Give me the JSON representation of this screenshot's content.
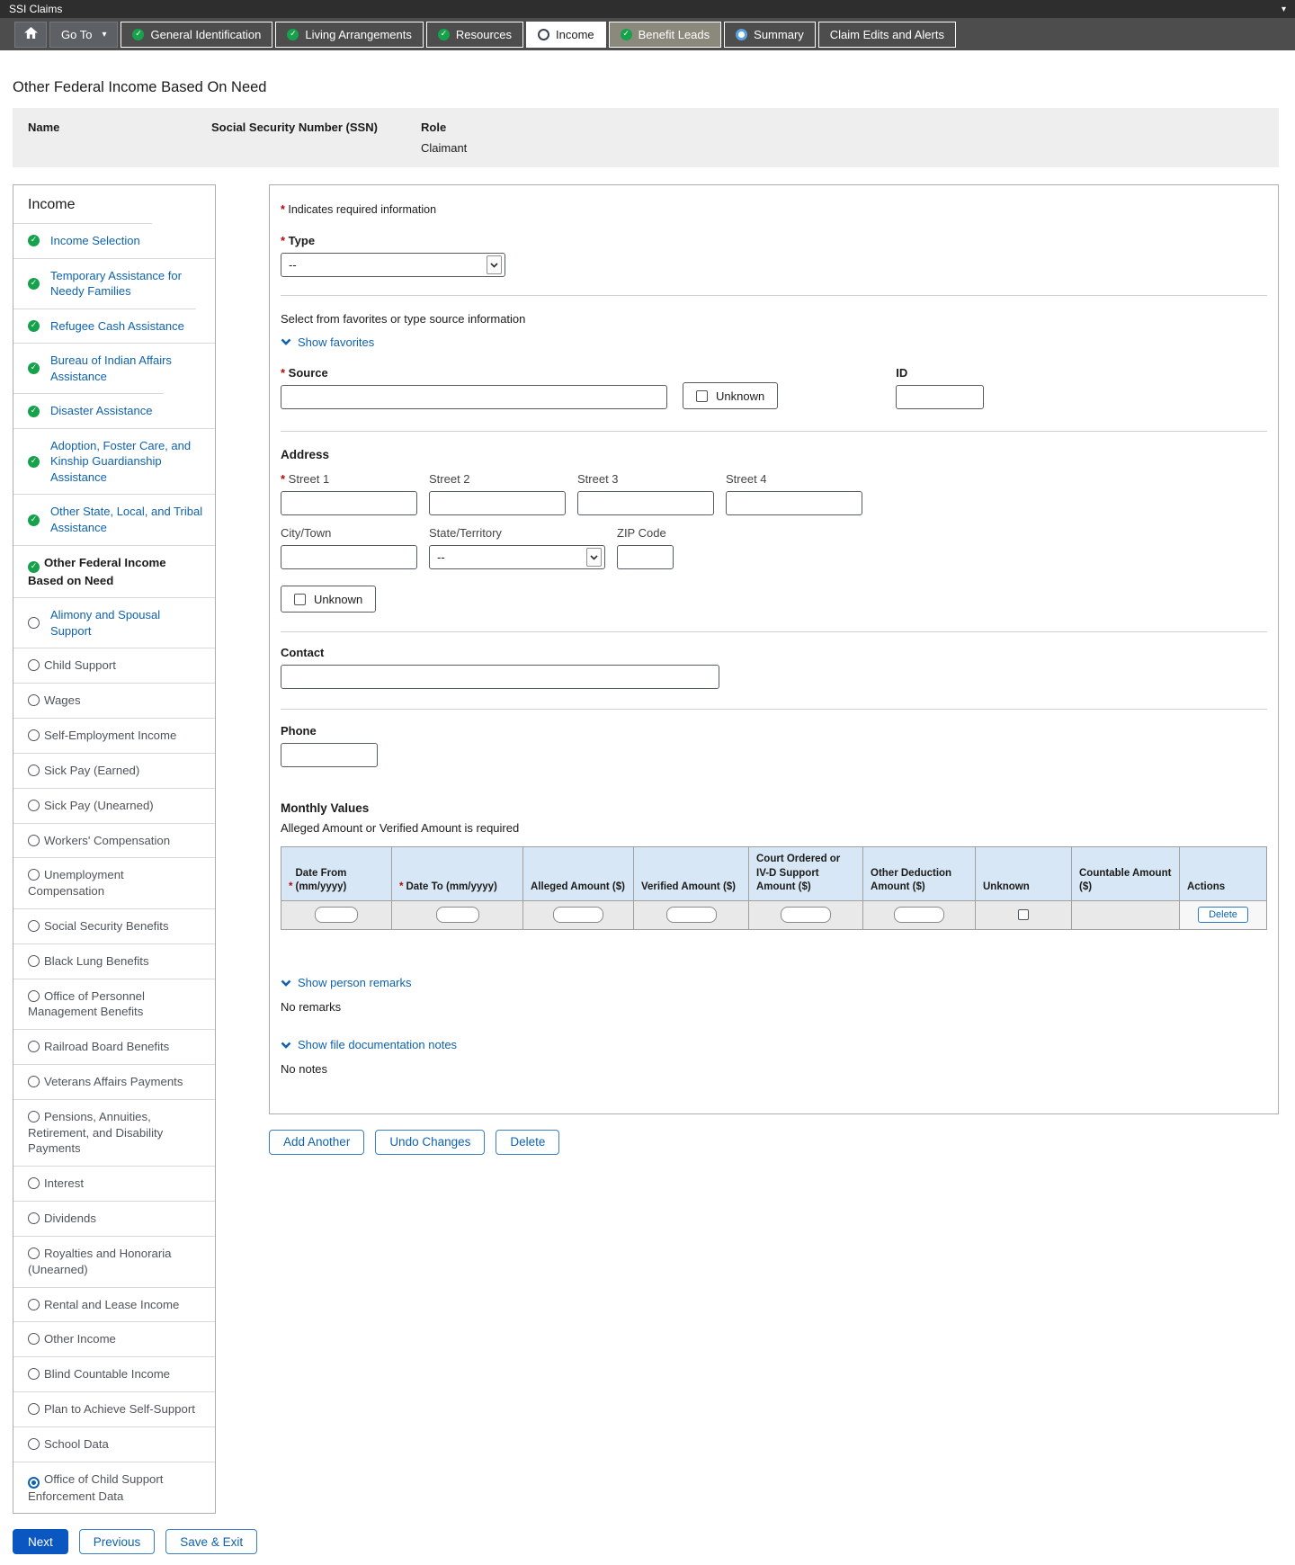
{
  "titlebar": {
    "title": "SSI Claims"
  },
  "nav": {
    "goto_label": "Go To",
    "tabs": [
      {
        "label": "General Identification",
        "icon": "check",
        "state": "default"
      },
      {
        "label": "Living Arrangements",
        "icon": "check",
        "state": "default"
      },
      {
        "label": "Resources",
        "icon": "check",
        "state": "default"
      },
      {
        "label": "Income",
        "icon": "circle",
        "state": "active"
      },
      {
        "label": "Benefit Leads",
        "icon": "check",
        "state": "muted"
      },
      {
        "label": "Summary",
        "icon": "dot",
        "state": "default"
      },
      {
        "label": "Claim Edits and Alerts",
        "icon": "none",
        "state": "default"
      }
    ]
  },
  "page": {
    "title": "Other Federal Income Based On Need"
  },
  "person": {
    "name_label": "Name",
    "ssn_label": "Social Security Number (SSN)",
    "role_label": "Role",
    "role_value": "Claimant"
  },
  "sidebar": {
    "title": "Income",
    "items": [
      {
        "label": "Income Selection",
        "icon": "check",
        "state": "link"
      },
      {
        "label": "Temporary Assistance for Needy Families",
        "icon": "check",
        "state": "link"
      },
      {
        "label": "Refugee Cash Assistance",
        "icon": "check",
        "state": "link"
      },
      {
        "label": "Bureau of Indian Affairs Assistance",
        "icon": "check",
        "state": "link"
      },
      {
        "label": "Disaster Assistance",
        "icon": "check",
        "state": "link"
      },
      {
        "label": "Adoption, Foster Care, and Kinship Guardianship Assistance",
        "icon": "check",
        "state": "link"
      },
      {
        "label": "Other State, Local, and Tribal Assistance",
        "icon": "check",
        "state": "link"
      },
      {
        "label": "Other Federal Income Based on Need",
        "icon": "check",
        "state": "current"
      },
      {
        "label": "Alimony and Spousal Support",
        "icon": "radio",
        "state": "link"
      },
      {
        "label": "Child Support",
        "icon": "radio",
        "state": "plain"
      },
      {
        "label": "Wages",
        "icon": "radio",
        "state": "plain"
      },
      {
        "label": "Self-Employment Income",
        "icon": "radio",
        "state": "plain"
      },
      {
        "label": "Sick Pay (Earned)",
        "icon": "radio",
        "state": "plain"
      },
      {
        "label": "Sick Pay (Unearned)",
        "icon": "radio",
        "state": "plain"
      },
      {
        "label": "Workers' Compensation",
        "icon": "radio",
        "state": "plain"
      },
      {
        "label": "Unemployment Compensation",
        "icon": "radio",
        "state": "plain"
      },
      {
        "label": "Social Security Benefits",
        "icon": "radio",
        "state": "plain"
      },
      {
        "label": "Black Lung Benefits",
        "icon": "radio",
        "state": "plain"
      },
      {
        "label": "Office of Personnel Management Benefits",
        "icon": "radio",
        "state": "plain"
      },
      {
        "label": "Railroad Board Benefits",
        "icon": "radio",
        "state": "plain"
      },
      {
        "label": "Veterans Affairs Payments",
        "icon": "radio",
        "state": "plain"
      },
      {
        "label": "Pensions, Annuities, Retirement, and Disability Payments",
        "icon": "radio",
        "state": "plain"
      },
      {
        "label": "Interest",
        "icon": "radio",
        "state": "plain"
      },
      {
        "label": "Dividends",
        "icon": "radio",
        "state": "plain"
      },
      {
        "label": "Royalties and Honoraria (Unearned)",
        "icon": "radio",
        "state": "plain"
      },
      {
        "label": "Rental and Lease Income",
        "icon": "radio",
        "state": "plain"
      },
      {
        "label": "Other Income",
        "icon": "radio",
        "state": "plain"
      },
      {
        "label": "Blind Countable Income",
        "icon": "radio",
        "state": "plain"
      },
      {
        "label": "Plan to Achieve Self-Support",
        "icon": "radio",
        "state": "plain"
      },
      {
        "label": "School Data",
        "icon": "radio",
        "state": "plain"
      },
      {
        "label": "Office of Child Support Enforcement Data",
        "icon": "radio-on",
        "state": "plain"
      }
    ]
  },
  "form": {
    "required_note": "Indicates required information",
    "type_label": "Type",
    "type_value": "--",
    "favorites_hint": "Select from favorites or type source information",
    "favorites_link": "Show favorites",
    "source_label": "Source",
    "source_unknown_label": "Unknown",
    "id_label": "ID",
    "address": {
      "label": "Address",
      "street1_label": "Street 1",
      "street2_label": "Street 2",
      "street3_label": "Street 3",
      "street4_label": "Street 4",
      "city_label": "City/Town",
      "state_label": "State/Territory",
      "state_value": "--",
      "zip_label": "ZIP Code",
      "unknown_label": "Unknown"
    },
    "contact_label": "Contact",
    "phone_label": "Phone",
    "monthly": {
      "label": "Monthly Values",
      "note": "Alleged Amount or Verified Amount is required",
      "columns": [
        {
          "label": "Date From (mm/yyyy)",
          "req": "*"
        },
        {
          "label": "Date To (mm/yyyy)",
          "req": "*"
        },
        {
          "label": "Alleged Amount ($)",
          "req": ""
        },
        {
          "label": "Verified Amount ($)",
          "req": ""
        },
        {
          "label": "Court Ordered or IV-D Support Amount ($)",
          "req": ""
        },
        {
          "label": "Other Deduction Amount ($)",
          "req": ""
        },
        {
          "label": "Unknown",
          "req": ""
        },
        {
          "label": "Countable Amount ($)",
          "req": ""
        },
        {
          "label": "Actions",
          "req": ""
        }
      ],
      "row_delete_label": "Delete"
    },
    "remarks_link": "Show person remarks",
    "remarks_empty": "No remarks",
    "notes_link": "Show file documentation notes",
    "notes_empty": "No notes",
    "buttons": {
      "add_another": "Add Another",
      "undo": "Undo Changes",
      "delete": "Delete"
    }
  },
  "footer": {
    "next": "Next",
    "previous": "Previous",
    "save_exit": "Save & Exit"
  }
}
